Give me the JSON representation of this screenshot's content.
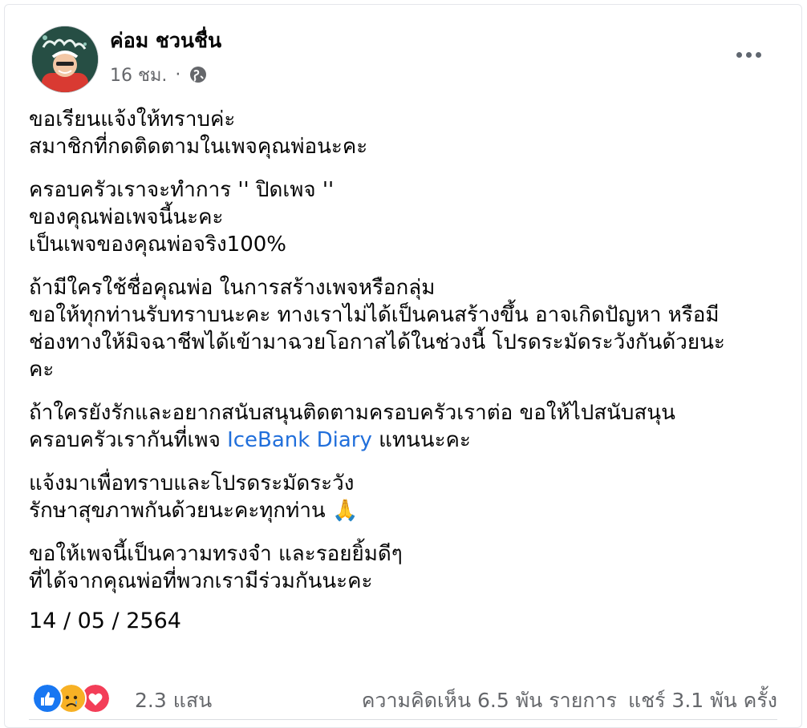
{
  "post": {
    "author": "ค่อม ชวนชื่น",
    "time": "16 ชม.",
    "meta_dot": "·",
    "paragraphs": [
      [
        "ขอเรียนแจ้งให้ทราบค่ะ",
        "สมาชิกที่กดติดตามในเพจคุณพ่อนะคะ"
      ],
      [
        "ครอบครัวเราจะทำการ '' ปิดเพจ ''",
        "ของคุณพ่อเพจนี้นะคะ",
        "เป็นเพจของคุณพ่อจริง100%"
      ],
      [
        "ถ้ามีใครใช้ชื่อคุณพ่อ ในการสร้างเพจหรือกลุ่ม",
        "ขอให้ทุกท่านรับทราบนะคะ ทางเราไม่ได้เป็นคนสร้างขึ้น อาจเกิดปัญหา หรือมี",
        "ช่องทางให้มิจฉาชีพได้เข้ามาฉวยโอกาสได้ในช่วงนี้ โปรดระมัดระวังกันด้วยนะ",
        "คะ"
      ],
      [
        "ถ้าใครยังรักและอยากสนับสนุนติดตามครอบครัวเราต่อ ขอให้ไปสนับสนุน"
      ],
      [
        "แจ้งมาเพื่อทราบและโปรดระมัดระวัง",
        "รักษาสุขภาพกันด้วยนะคะทุกท่าน"
      ],
      [
        "ขอให้เพจนี้เป็นความทรงจำ และรอยยิ้มดีๆ",
        "ที่ได้จากคุณพ่อที่พวกเรามีร่วมกันนะคะ"
      ]
    ],
    "link_line": {
      "prefix": "ครอบครัวเรากันที่เพจ ",
      "link_text": "IceBank Diary",
      "suffix": "  แทนนะคะ"
    },
    "emoji": "🙏",
    "date": "14 / 05 / 2564",
    "reaction_count": "2.3 แสน",
    "comments": "ความคิดเห็น 6.5 พัน รายการ",
    "shares": "แชร์ 3.1 พัน ครั้ง",
    "reactions": [
      "like-icon",
      "sad-icon",
      "love-icon"
    ]
  },
  "colors": {
    "link": "#216fdb",
    "like": "#1877f2",
    "love": "#f33e58",
    "sad": "#f7b125",
    "muted": "#65676b"
  }
}
